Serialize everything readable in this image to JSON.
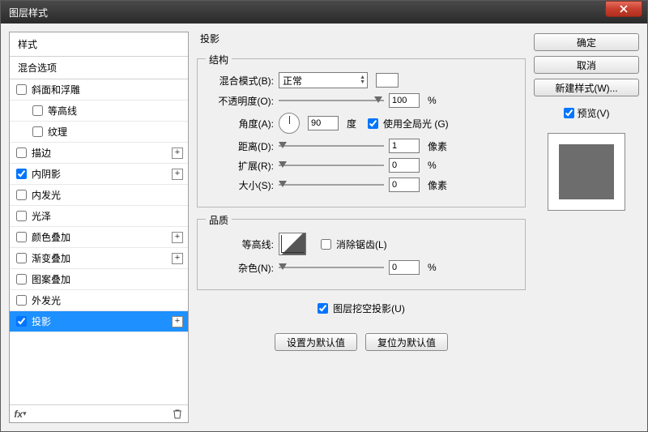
{
  "window": {
    "title": "图层样式"
  },
  "sidebar": {
    "header": "样式",
    "blend_header": "混合选项",
    "items": [
      {
        "label": "斜面和浮雕",
        "checked": false,
        "has_plus": false,
        "indent": false
      },
      {
        "label": "等高线",
        "checked": false,
        "has_plus": false,
        "indent": true
      },
      {
        "label": "纹理",
        "checked": false,
        "has_plus": false,
        "indent": true
      },
      {
        "label": "描边",
        "checked": false,
        "has_plus": true,
        "indent": false
      },
      {
        "label": "内阴影",
        "checked": true,
        "has_plus": true,
        "indent": false
      },
      {
        "label": "内发光",
        "checked": false,
        "has_plus": false,
        "indent": false
      },
      {
        "label": "光泽",
        "checked": false,
        "has_plus": false,
        "indent": false
      },
      {
        "label": "颜色叠加",
        "checked": false,
        "has_plus": true,
        "indent": false
      },
      {
        "label": "渐变叠加",
        "checked": false,
        "has_plus": true,
        "indent": false
      },
      {
        "label": "图案叠加",
        "checked": false,
        "has_plus": false,
        "indent": false
      },
      {
        "label": "外发光",
        "checked": false,
        "has_plus": false,
        "indent": false
      },
      {
        "label": "投影",
        "checked": true,
        "has_plus": true,
        "indent": false,
        "selected": true
      }
    ],
    "footer_fx": "fx"
  },
  "main": {
    "section_title": "投影",
    "structure": {
      "legend": "结构",
      "blend_mode_label": "混合模式(B):",
      "blend_mode_value": "正常",
      "opacity_label": "不透明度(O):",
      "opacity_value": "100",
      "opacity_unit": "%",
      "angle_label": "角度(A):",
      "angle_value": "90",
      "angle_unit": "度",
      "global_light_label": "使用全局光 (G)",
      "global_light_checked": true,
      "distance_label": "距离(D):",
      "distance_value": "1",
      "distance_unit": "像素",
      "spread_label": "扩展(R):",
      "spread_value": "0",
      "spread_unit": "%",
      "size_label": "大小(S):",
      "size_value": "0",
      "size_unit": "像素"
    },
    "quality": {
      "legend": "品质",
      "contour_label": "等高线:",
      "antialias_label": "消除锯齿(L)",
      "antialias_checked": false,
      "noise_label": "杂色(N):",
      "noise_value": "0",
      "noise_unit": "%"
    },
    "knockout_label": "图层挖空投影(U)",
    "knockout_checked": true,
    "make_default": "设置为默认值",
    "reset_default": "复位为默认值"
  },
  "right": {
    "ok": "确定",
    "cancel": "取消",
    "new_style": "新建样式(W)...",
    "preview_label": "预览(V)",
    "preview_checked": true
  }
}
